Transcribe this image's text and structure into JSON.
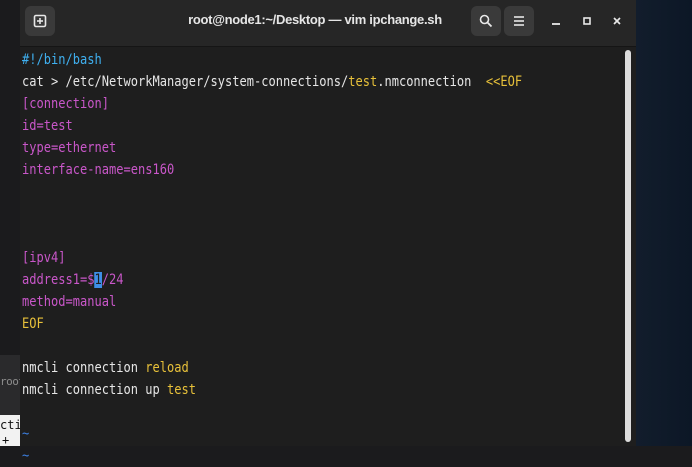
{
  "window": {
    "title": "root@node1:~/Desktop — vim ipchange.sh",
    "buttons": {
      "new_tab": "⊞",
      "search": "⚲",
      "menu": "≡",
      "minimize": "_",
      "maximize": "▫",
      "close": "×"
    }
  },
  "background_window": {
    "fragment_1": "root",
    "fragment_2": "cti",
    "fragment_3": "+"
  },
  "editor": {
    "lines": [
      {
        "segments": [
          {
            "text": "#!/bin/bash",
            "style": "shebang"
          }
        ]
      },
      {
        "segments": [
          {
            "text": "cat > /etc/NetworkManager/system-connections/",
            "style": "plain"
          },
          {
            "text": "test",
            "style": "yellow"
          },
          {
            "text": ".nmconnection  ",
            "style": "plain"
          },
          {
            "text": "<<EOF",
            "style": "yellow"
          }
        ]
      },
      {
        "segments": [
          {
            "text": "[connection]",
            "style": "magenta"
          }
        ]
      },
      {
        "segments": [
          {
            "text": "id=test",
            "style": "magenta"
          }
        ]
      },
      {
        "segments": [
          {
            "text": "type=ethernet",
            "style": "magenta"
          }
        ]
      },
      {
        "segments": [
          {
            "text": "interface-name=ens160",
            "style": "magenta"
          }
        ]
      },
      {
        "segments": []
      },
      {
        "segments": []
      },
      {
        "segments": []
      },
      {
        "segments": [
          {
            "text": "[ipv4]",
            "style": "magenta"
          }
        ]
      },
      {
        "segments": [
          {
            "text": "address1=$",
            "style": "magenta"
          },
          {
            "text": "1",
            "style": "cursor"
          },
          {
            "text": "/24",
            "style": "magenta"
          }
        ]
      },
      {
        "segments": [
          {
            "text": "method=manual",
            "style": "magenta"
          }
        ]
      },
      {
        "segments": [
          {
            "text": "EOF",
            "style": "yellow"
          }
        ]
      },
      {
        "segments": []
      },
      {
        "segments": [
          {
            "text": "nmcli connection ",
            "style": "plain"
          },
          {
            "text": "reload",
            "style": "yellow"
          }
        ]
      },
      {
        "segments": [
          {
            "text": "nmcli connection up ",
            "style": "plain"
          },
          {
            "text": "test",
            "style": "yellow"
          }
        ]
      },
      {
        "segments": []
      },
      {
        "segments": [
          {
            "text": "~",
            "style": "tilde"
          }
        ]
      },
      {
        "segments": [
          {
            "text": "~",
            "style": "tilde"
          }
        ]
      }
    ]
  },
  "colors": {
    "plain": "#e6e6e6",
    "shebang": "#3fb0f0",
    "magenta": "#c957c9",
    "yellow": "#e8c13a",
    "tilde": "#3c7fe0",
    "cursor_bg": "#3e8fe8"
  }
}
